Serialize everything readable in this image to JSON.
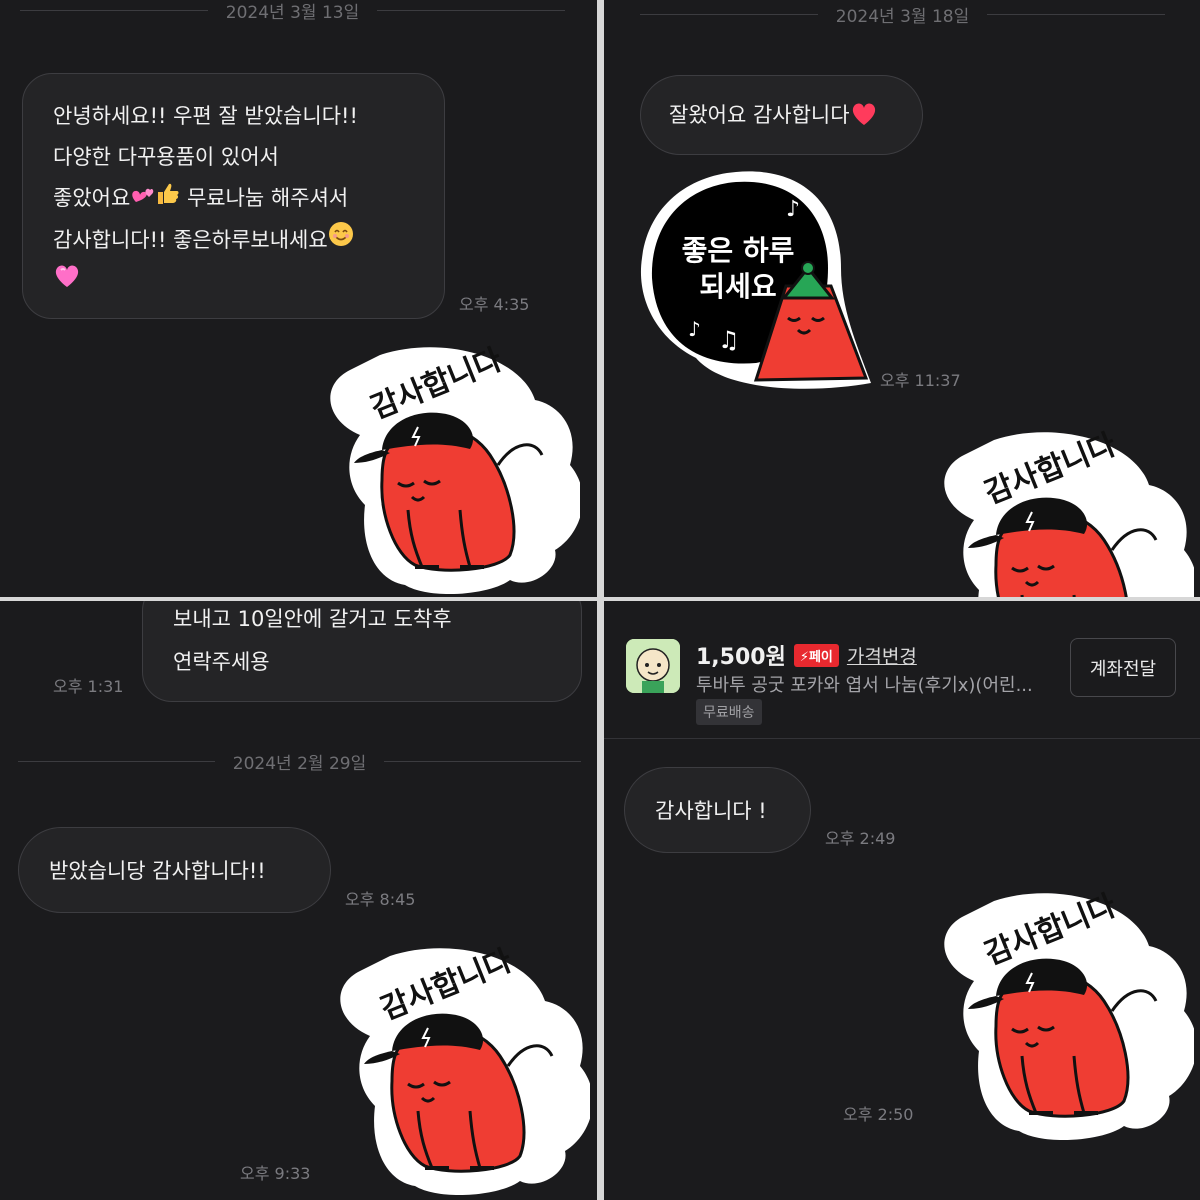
{
  "panel1": {
    "date": "2024년 3월 13일",
    "message_lines": [
      "안녕하세요!! 우편 잘 받았습니다!!",
      "다양한 다꾸용품이 있어서",
      "좋았어요",
      "무료나눔 해주셔서",
      "감사합니다!! 좋은하루보내세요"
    ],
    "time": "오후 4:35",
    "sticker_text": "감사합니다"
  },
  "panel2": {
    "date": "2024년 3월 18일",
    "message": "잘왔어요 감사합니다",
    "sticker_bubble_lines": [
      "좋은 하루",
      "되세요"
    ],
    "sticker_time": "오후 11:37",
    "sticker2_text": "감사합니다"
  },
  "panel3": {
    "prev_message_lines": [
      "보내고 10일안에 갈거고 도착후",
      "연락주세용"
    ],
    "prev_time": "오후 1:31",
    "date": "2024년 2월 29일",
    "message": "받았습니당 감사합니다!!",
    "time": "오후 8:45",
    "sticker_text": "감사합니다",
    "sticker_time": "오후 9:33"
  },
  "panel4": {
    "product": {
      "price": "1,500원",
      "pay_badge": "페이",
      "change_price": "가격변경",
      "title": "투바투 공굿 포카와 엽서 나눔(후기x)(어린...",
      "shipping": "무료배송",
      "transfer_button": "계좌전달"
    },
    "message": "감사합니다 !",
    "time": "오후 2:49",
    "sticker_text": "감사합니다",
    "sticker_time": "오후 2:50"
  },
  "colors": {
    "background": "#1b1b1d",
    "bubble": "#242426",
    "character_red": "#ef3d33",
    "pay_red": "#e8292f"
  }
}
